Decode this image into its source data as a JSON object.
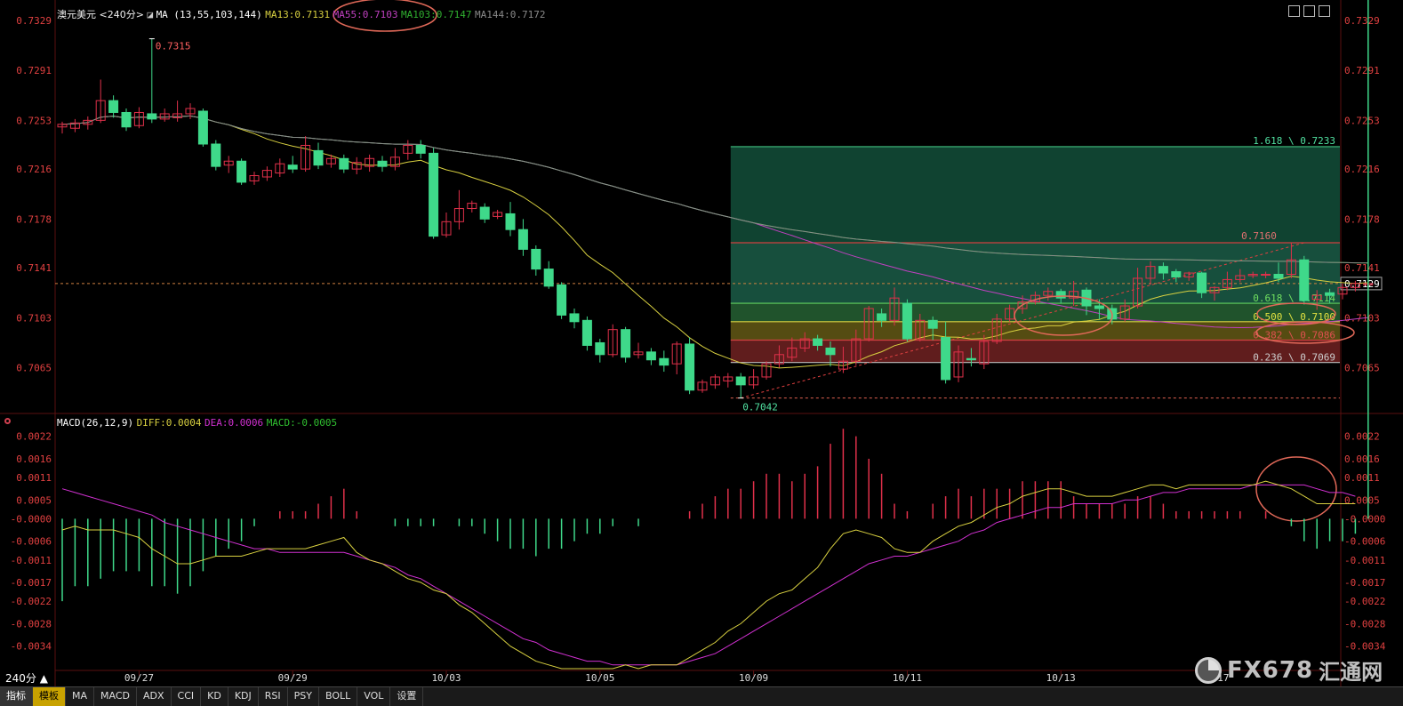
{
  "header": {
    "symbol": "澳元美元",
    "period_tag": "<240分>",
    "ma_label": "MA (13,55,103,144)",
    "ma13": "MA13:0.7131",
    "ma55": "MA55:0.7103",
    "ma103": "MA103:0.7147",
    "ma144": "MA144:0.7172"
  },
  "macd_header": {
    "label": "MACD(26,12,9)",
    "diff": "DIFF:0.0004",
    "dea": "DEA:0.0006",
    "macd": "MACD:-0.0005"
  },
  "period_selector": "240分 ▲",
  "tabs": [
    "指标",
    "模板",
    "MA",
    "MACD",
    "ADX",
    "CCI",
    "KD",
    "KDJ",
    "RSI",
    "PSY",
    "BOLL",
    "VOL",
    "设置"
  ],
  "watermark": {
    "text": "FX678",
    "cn": "汇通网"
  },
  "colors": {
    "up": "#e0304a",
    "down": "#3fd98a",
    "ma13": "#d8d040",
    "ma55": "#c040c0",
    "ma103": "#30b030",
    "ma144": "#8a8a8a",
    "diff": "#d8d040",
    "dea": "#d030d0",
    "axis_text": "#e04040",
    "grid_dash": "#e06050"
  },
  "chart_data": [
    {
      "type": "candlestick",
      "title": "澳元美元<240分>",
      "ylim": [
        0.7035,
        0.7335
      ],
      "yticks": [
        "0.7329",
        "0.7291",
        "0.7253",
        "0.7216",
        "0.7178",
        "0.7141",
        "0.7103",
        "0.7065"
      ],
      "xticks": [
        {
          "label": "09/27",
          "i": 6
        },
        {
          "label": "09/29",
          "i": 18
        },
        {
          "label": "10/03",
          "i": 30
        },
        {
          "label": "10/05",
          "i": 42
        },
        {
          "label": "10/09",
          "i": 54
        },
        {
          "label": "10/11",
          "i": 66
        },
        {
          "label": "10/13",
          "i": 78
        },
        {
          "label": "10/17",
          "i": 90
        }
      ],
      "current_price": "0.7129",
      "annotations": {
        "high": "0.7315",
        "low": "0.7042",
        "swing_high": "0.7160"
      },
      "fibonacci": [
        {
          "label": "1.618 \\ 0.7233",
          "value": 0.7233
        },
        {
          "label": "0.7160",
          "value": 0.716
        },
        {
          "label": "0.618 \\ 0.7114",
          "value": 0.7114
        },
        {
          "label": "0.500 \\ 0.7100",
          "value": 0.71
        },
        {
          "label": "0.382 \\ 0.7086",
          "value": 0.7086
        },
        {
          "label": "0.236 \\ 0.7069",
          "value": 0.7069
        },
        {
          "label": "",
          "value": 0.7042
        }
      ],
      "candles": [
        [
          0.7248,
          0.725,
          0.7243,
          0.7252
        ],
        [
          0.7247,
          0.7251,
          0.7244,
          0.7254
        ],
        [
          0.725,
          0.7253,
          0.7246,
          0.7256
        ],
        [
          0.7253,
          0.7268,
          0.7251,
          0.7284
        ],
        [
          0.7268,
          0.7259,
          0.7255,
          0.7272
        ],
        [
          0.7259,
          0.7248,
          0.7245,
          0.7262
        ],
        [
          0.7249,
          0.7259,
          0.7247,
          0.7263
        ],
        [
          0.7258,
          0.7254,
          0.7251,
          0.7315
        ],
        [
          0.7254,
          0.7258,
          0.7252,
          0.7262
        ],
        [
          0.7255,
          0.7258,
          0.7252,
          0.7268
        ],
        [
          0.7258,
          0.7262,
          0.7254,
          0.7266
        ],
        [
          0.726,
          0.7235,
          0.7233,
          0.7262
        ],
        [
          0.7235,
          0.7218,
          0.7215,
          0.7238
        ],
        [
          0.7219,
          0.7222,
          0.7213,
          0.7226
        ],
        [
          0.7222,
          0.7206,
          0.7204,
          0.7224
        ],
        [
          0.7207,
          0.7211,
          0.7204,
          0.7214
        ],
        [
          0.721,
          0.7215,
          0.7207,
          0.7218
        ],
        [
          0.7213,
          0.722,
          0.721,
          0.7224
        ],
        [
          0.7219,
          0.7216,
          0.7213,
          0.7226
        ],
        [
          0.7216,
          0.7234,
          0.7214,
          0.7241
        ],
        [
          0.723,
          0.7219,
          0.7216,
          0.7236
        ],
        [
          0.722,
          0.7224,
          0.7217,
          0.7227
        ],
        [
          0.7224,
          0.7216,
          0.7213,
          0.7227
        ],
        [
          0.7216,
          0.7221,
          0.7212,
          0.7225
        ],
        [
          0.7218,
          0.7224,
          0.7214,
          0.7227
        ],
        [
          0.7222,
          0.7218,
          0.7214,
          0.7226
        ],
        [
          0.7218,
          0.7225,
          0.7215,
          0.7232
        ],
        [
          0.7228,
          0.7234,
          0.7223,
          0.7238
        ],
        [
          0.7234,
          0.7228,
          0.7224,
          0.7238
        ],
        [
          0.7228,
          0.7165,
          0.7163,
          0.7232
        ],
        [
          0.7166,
          0.7176,
          0.7164,
          0.7183
        ],
        [
          0.7176,
          0.7186,
          0.717,
          0.72
        ],
        [
          0.7186,
          0.719,
          0.7183,
          0.7192
        ],
        [
          0.7187,
          0.7178,
          0.7175,
          0.719
        ],
        [
          0.718,
          0.7183,
          0.7178,
          0.7185
        ],
        [
          0.7182,
          0.717,
          0.7165,
          0.7191
        ],
        [
          0.717,
          0.7155,
          0.715,
          0.7178
        ],
        [
          0.7155,
          0.714,
          0.7135,
          0.7158
        ],
        [
          0.714,
          0.7127,
          0.7125,
          0.7146
        ],
        [
          0.7128,
          0.7105,
          0.7102,
          0.713
        ],
        [
          0.7106,
          0.71,
          0.7095,
          0.711
        ],
        [
          0.7101,
          0.7082,
          0.7078,
          0.7104
        ],
        [
          0.7084,
          0.7075,
          0.7069,
          0.7087
        ],
        [
          0.7075,
          0.7094,
          0.7073,
          0.7098
        ],
        [
          0.7094,
          0.7073,
          0.7069,
          0.7096
        ],
        [
          0.7075,
          0.7077,
          0.7072,
          0.7084
        ],
        [
          0.7077,
          0.7071,
          0.7067,
          0.708
        ],
        [
          0.7072,
          0.7067,
          0.7062,
          0.7078
        ],
        [
          0.7068,
          0.7083,
          0.706,
          0.7085
        ],
        [
          0.7083,
          0.7048,
          0.7045,
          0.7088
        ],
        [
          0.7048,
          0.7054,
          0.7046,
          0.7056
        ],
        [
          0.7052,
          0.7058,
          0.7049,
          0.706
        ],
        [
          0.7055,
          0.7058,
          0.705,
          0.7061
        ],
        [
          0.7058,
          0.7052,
          0.7042,
          0.7061
        ],
        [
          0.7052,
          0.7058,
          0.7049,
          0.7064
        ],
        [
          0.7058,
          0.7068,
          0.7056,
          0.707
        ],
        [
          0.7068,
          0.7075,
          0.7065,
          0.7082
        ],
        [
          0.7073,
          0.708,
          0.707,
          0.7088
        ],
        [
          0.708,
          0.7087,
          0.7077,
          0.7092
        ],
        [
          0.7087,
          0.7082,
          0.7078,
          0.709
        ],
        [
          0.708,
          0.7075,
          0.7066,
          0.7085
        ],
        [
          0.7064,
          0.707,
          0.7061,
          0.7081
        ],
        [
          0.707,
          0.7087,
          0.7067,
          0.7094
        ],
        [
          0.7087,
          0.711,
          0.7085,
          0.7112
        ],
        [
          0.7106,
          0.7101,
          0.7096,
          0.711
        ],
        [
          0.7101,
          0.7118,
          0.7097,
          0.7126
        ],
        [
          0.7114,
          0.7087,
          0.7085,
          0.7117
        ],
        [
          0.7087,
          0.7101,
          0.7085,
          0.7106
        ],
        [
          0.7101,
          0.7095,
          0.7086,
          0.7104
        ],
        [
          0.7088,
          0.7056,
          0.7053,
          0.71
        ],
        [
          0.7058,
          0.7077,
          0.7054,
          0.7082
        ],
        [
          0.7072,
          0.7071,
          0.7066,
          0.708
        ],
        [
          0.7068,
          0.7085,
          0.7064,
          0.709
        ],
        [
          0.7085,
          0.7102,
          0.7083,
          0.7106
        ],
        [
          0.7102,
          0.711,
          0.71,
          0.7113
        ],
        [
          0.711,
          0.7115,
          0.7106,
          0.712
        ],
        [
          0.7115,
          0.712,
          0.7113,
          0.7123
        ],
        [
          0.712,
          0.7123,
          0.7116,
          0.7126
        ],
        [
          0.7123,
          0.7118,
          0.7114,
          0.7125
        ],
        [
          0.7118,
          0.7123,
          0.7112,
          0.7131
        ],
        [
          0.7124,
          0.7112,
          0.7105,
          0.7126
        ],
        [
          0.7112,
          0.711,
          0.7102,
          0.7117
        ],
        [
          0.711,
          0.7102,
          0.7098,
          0.7113
        ],
        [
          0.7102,
          0.7112,
          0.71,
          0.7117
        ],
        [
          0.7112,
          0.7133,
          0.711,
          0.7141
        ],
        [
          0.7133,
          0.7142,
          0.7128,
          0.7146
        ],
        [
          0.7142,
          0.7137,
          0.7132,
          0.7145
        ],
        [
          0.7138,
          0.7134,
          0.713,
          0.714
        ],
        [
          0.7134,
          0.7137,
          0.7131,
          0.7138
        ],
        [
          0.7137,
          0.7122,
          0.7118,
          0.7138
        ],
        [
          0.7122,
          0.7126,
          0.7116,
          0.7127
        ],
        [
          0.7126,
          0.7132,
          0.7124,
          0.7138
        ],
        [
          0.7132,
          0.7135,
          0.713,
          0.714
        ],
        [
          0.7135,
          0.7136,
          0.7133,
          0.7138
        ],
        [
          0.7136,
          0.7136,
          0.7133,
          0.7138
        ],
        [
          0.7136,
          0.7133,
          0.713,
          0.7145
        ],
        [
          0.7136,
          0.7147,
          0.7133,
          0.716
        ],
        [
          0.7147,
          0.7116,
          0.7113,
          0.715
        ],
        [
          0.7117,
          0.712,
          0.7109,
          0.7124
        ],
        [
          0.7122,
          0.712,
          0.7114,
          0.7125
        ],
        [
          0.7121,
          0.7126,
          0.7117,
          0.7129
        ],
        [
          0.7126,
          0.7129,
          0.7123,
          0.7131
        ],
        [
          0.7128,
          0.7129,
          0.7124,
          0.7131
        ]
      ]
    },
    {
      "type": "macd",
      "title": "MACD(26,12,9)",
      "ylim": [
        -0.004,
        0.0025
      ],
      "yticks": [
        "0.0022",
        "0.0016",
        "0.0011",
        "0.0005",
        "-0.0000",
        "-0.0006",
        "-0.0011",
        "-0.0017",
        "-0.0022",
        "-0.0028",
        "-0.0034"
      ],
      "series": [
        {
          "name": "DIFF",
          "values": [
            -0.0003,
            -0.0002,
            -0.0003,
            -0.0003,
            -0.0003,
            -0.0004,
            -0.0005,
            -0.0008,
            -0.001,
            -0.0012,
            -0.0012,
            -0.0011,
            -0.001,
            -0.001,
            -0.001,
            -0.0009,
            -0.0008,
            -0.0008,
            -0.0008,
            -0.0008,
            -0.0007,
            -0.0006,
            -0.0005,
            -0.0009,
            -0.0011,
            -0.0012,
            -0.0014,
            -0.0016,
            -0.0017,
            -0.0019,
            -0.002,
            -0.0023,
            -0.0025,
            -0.0028,
            -0.0031,
            -0.0034,
            -0.0036,
            -0.0038,
            -0.0039,
            -0.004,
            -0.004,
            -0.004,
            -0.004,
            -0.004,
            -0.0039,
            -0.004,
            -0.0039,
            -0.0039,
            -0.0039,
            -0.0037,
            -0.0035,
            -0.0033,
            -0.003,
            -0.0028,
            -0.0025,
            -0.0022,
            -0.002,
            -0.0019,
            -0.0016,
            -0.0013,
            -0.0008,
            -0.0004,
            -0.0003,
            -0.0004,
            -0.0005,
            -0.0008,
            -0.0009,
            -0.0009,
            -0.0006,
            -0.0004,
            -0.0002,
            -0.0001,
            0.0001,
            0.0003,
            0.0004,
            0.0006,
            0.0007,
            0.0008,
            0.0008,
            0.0007,
            0.0006,
            0.0006,
            0.0006,
            0.0007,
            0.0008,
            0.0009,
            0.0009,
            0.0008,
            0.0009,
            0.0009,
            0.0009,
            0.0009,
            0.0009,
            0.0009,
            0.001,
            0.0009,
            0.0008,
            0.0006,
            0.0004,
            0.0004,
            0.0004,
            0.0004
          ]
        },
        {
          "name": "DEA",
          "values": [
            0.0008,
            0.0007,
            0.0006,
            0.0005,
            0.0004,
            0.0003,
            0.0002,
            0.0001,
            -0.0001,
            -0.0002,
            -0.0003,
            -0.0004,
            -0.0005,
            -0.0006,
            -0.0007,
            -0.0008,
            -0.0008,
            -0.0009,
            -0.0009,
            -0.0009,
            -0.0009,
            -0.0009,
            -0.0009,
            -0.001,
            -0.0011,
            -0.0012,
            -0.0013,
            -0.0015,
            -0.0016,
            -0.0018,
            -0.002,
            -0.0022,
            -0.0024,
            -0.0026,
            -0.0028,
            -0.003,
            -0.0032,
            -0.0033,
            -0.0035,
            -0.0036,
            -0.0037,
            -0.0038,
            -0.0038,
            -0.0039,
            -0.0039,
            -0.0039,
            -0.0039,
            -0.0039,
            -0.0039,
            -0.0038,
            -0.0037,
            -0.0036,
            -0.0034,
            -0.0032,
            -0.003,
            -0.0028,
            -0.0026,
            -0.0024,
            -0.0022,
            -0.002,
            -0.0018,
            -0.0016,
            -0.0014,
            -0.0012,
            -0.0011,
            -0.001,
            -0.001,
            -0.0009,
            -0.0008,
            -0.0007,
            -0.0006,
            -0.0004,
            -0.0003,
            -0.0001,
            0.0,
            0.0001,
            0.0002,
            0.0003,
            0.0003,
            0.0004,
            0.0004,
            0.0004,
            0.0004,
            0.0005,
            0.0005,
            0.0006,
            0.0007,
            0.0007,
            0.0008,
            0.0008,
            0.0008,
            0.0008,
            0.0008,
            0.0009,
            0.0009,
            0.0009,
            0.0009,
            0.0009,
            0.0008,
            0.0007,
            0.0007,
            0.0006
          ]
        }
      ]
    }
  ]
}
